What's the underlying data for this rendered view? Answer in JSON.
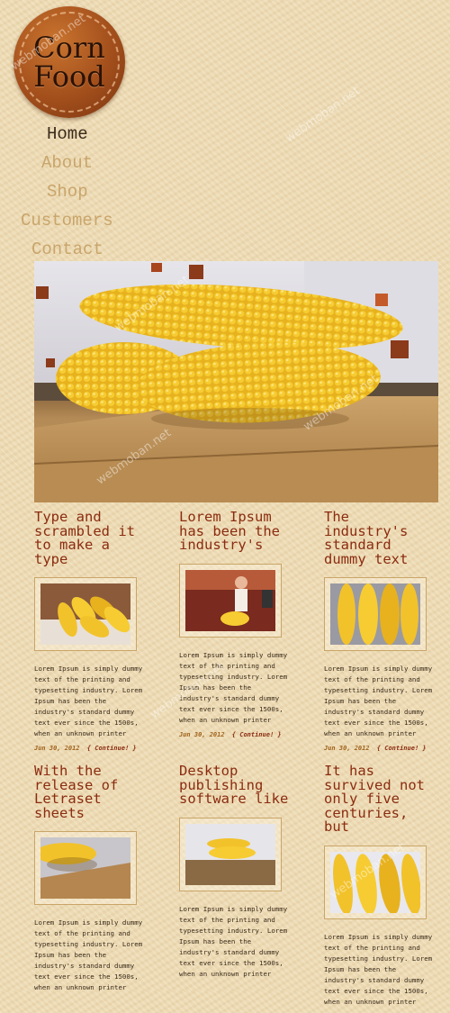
{
  "logo": {
    "line1": "Corn",
    "line2": "Food"
  },
  "nav": [
    {
      "label": "Home",
      "active": true
    },
    {
      "label": "About",
      "active": false
    },
    {
      "label": "Shop",
      "active": false
    },
    {
      "label": "Customers",
      "active": false
    },
    {
      "label": "Contact",
      "active": false
    }
  ],
  "articles": [
    {
      "title": "Type and scrambled it to make a type",
      "text": "Lorem Ipsum is simply dummy text of the printing and typesetting industry. Lorem Ipsum has been the industry's standard dummy text ever since the 1500s, when an unknown printer",
      "date": "Jun 30, 2012",
      "continue": "{ Continue! }"
    },
    {
      "title": "Lorem Ipsum has been the industry's",
      "text": "Lorem Ipsum is simply dummy text of the printing and typesetting industry. Lorem Ipsum has been the industry's standard dummy text ever since the 1500s, when an unknown printer",
      "date": "Jun 30, 2012",
      "continue": "{ Continue! }"
    },
    {
      "title": "The industry's standard dummy text",
      "text": "Lorem Ipsum is simply dummy text of the printing and typesetting industry. Lorem Ipsum has been the industry's standard dummy text ever since the 1500s, when an unknown printer",
      "date": "Jun 30, 2012",
      "continue": "{ Continue! }"
    },
    {
      "title": "With the release of Letraset sheets",
      "text": "Lorem Ipsum is simply dummy text of the printing and typesetting industry. Lorem Ipsum has been the industry's standard dummy text ever since the 1500s, when an unknown printer"
    },
    {
      "title": "Desktop publishing software like",
      "text": "Lorem Ipsum is simply dummy text of the printing and typesetting industry. Lorem Ipsum has been the industry's standard dummy text ever since the 1500s, when an unknown printer"
    },
    {
      "title": "It has survived not only five centuries, but",
      "text": "Lorem Ipsum is simply dummy text of the printing and typesetting industry. Lorem Ipsum has been the industry's standard dummy text ever since the 1500s, when an unknown printer"
    }
  ],
  "watermark": "webmoban.net"
}
